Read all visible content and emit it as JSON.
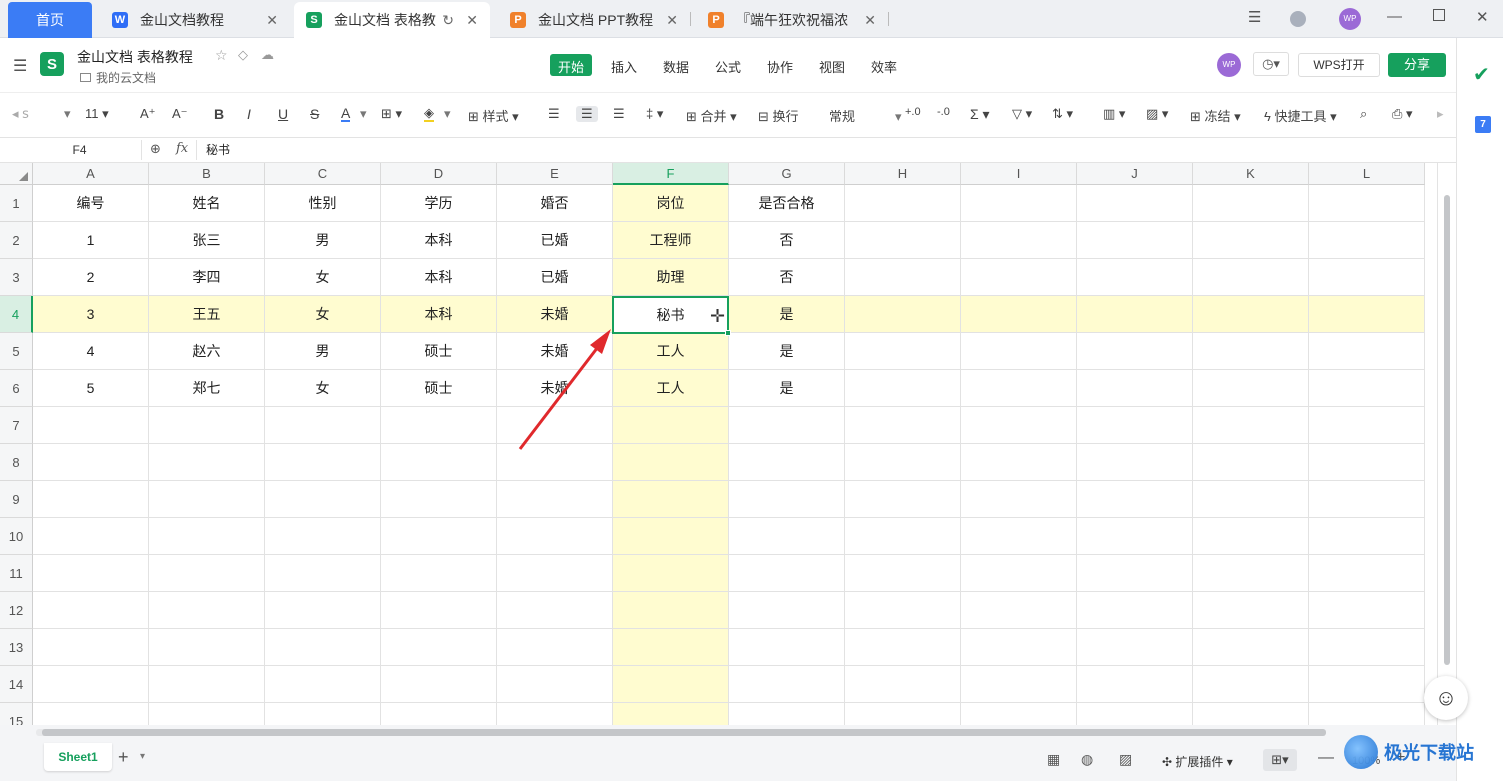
{
  "tabs": {
    "home": "首页",
    "items": [
      {
        "label": "金山文档教程",
        "icon": "W"
      },
      {
        "label": "金山文档 表格教",
        "icon": "S"
      },
      {
        "label": "金山文档 PPT教程",
        "icon": "P"
      },
      {
        "label": "『端午狂欢祝福浓",
        "icon": "P"
      }
    ]
  },
  "user": {
    "avatar": "WP"
  },
  "doc": {
    "title": "金山文档 表格教程",
    "location": "我的云文档",
    "logo": "S"
  },
  "menus": [
    "开始",
    "插入",
    "数据",
    "公式",
    "协作",
    "视图",
    "效率"
  ],
  "header_actions": {
    "open_wps": "WPS打开",
    "share": "分享"
  },
  "toolbar": {
    "font_size": "11",
    "bold": "B",
    "italic": "I",
    "underline": "U",
    "strike": "S",
    "font_color": "A",
    "style": "样式",
    "merge": "合并",
    "wrap": "换行",
    "number_format": "常规",
    "freeze": "冻结",
    "quick_tools": "快捷工具"
  },
  "formula_bar": {
    "cell_ref": "F4",
    "fx": "fx",
    "value": "秘书"
  },
  "columns": [
    "A",
    "B",
    "C",
    "D",
    "E",
    "F",
    "G",
    "H",
    "I",
    "J",
    "K",
    "L"
  ],
  "rows": [
    "1",
    "2",
    "3",
    "4",
    "5",
    "6",
    "7",
    "8",
    "9",
    "10",
    "11",
    "12",
    "13",
    "14",
    "15"
  ],
  "table": [
    [
      "编号",
      "姓名",
      "性别",
      "学历",
      "婚否",
      "岗位",
      "是否合格"
    ],
    [
      "1",
      "张三",
      "男",
      "本科",
      "已婚",
      "工程师",
      "否"
    ],
    [
      "2",
      "李四",
      "女",
      "本科",
      "已婚",
      "助理",
      "否"
    ],
    [
      "3",
      "王五",
      "女",
      "本科",
      "未婚",
      "秘书",
      "是"
    ],
    [
      "4",
      "赵六",
      "男",
      "硕士",
      "未婚",
      "工人",
      "是"
    ],
    [
      "5",
      "郑七",
      "女",
      "硕士",
      "未婚",
      "工人",
      "是"
    ]
  ],
  "selection": {
    "cell": "F4",
    "column": "F",
    "row": "4"
  },
  "sheets": [
    "Sheet1"
  ],
  "status": {
    "extensions": "扩展插件",
    "zoom": "100%"
  },
  "sidebar": {
    "calendar_day": "7"
  },
  "watermark": "极光下载站"
}
